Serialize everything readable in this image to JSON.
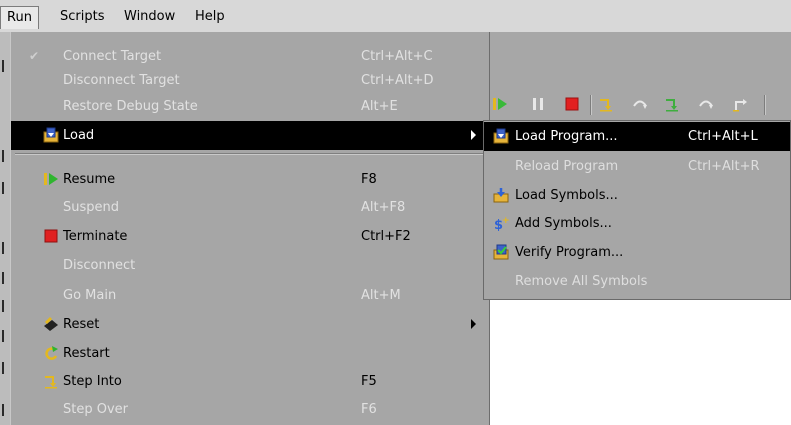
{
  "menubar": {
    "items": [
      "Run",
      "Scripts",
      "Window",
      "Help"
    ]
  },
  "run_menu": {
    "items": [
      {
        "label": "Connect Target",
        "accel": "Ctrl+Alt+C",
        "enabled": false,
        "checked": true
      },
      {
        "label": "Disconnect Target",
        "accel": "Ctrl+Alt+D",
        "enabled": false
      },
      {
        "label": "Restore Debug State",
        "accel": "Alt+E",
        "enabled": false
      },
      {
        "label": "Load",
        "accel": "",
        "enabled": true,
        "highlighted": true,
        "submenu": true,
        "icon": "load-icon"
      },
      {
        "label": "Resume",
        "accel": "F8",
        "enabled": true,
        "icon": "resume-icon"
      },
      {
        "label": "Suspend",
        "accel": "Alt+F8",
        "enabled": false
      },
      {
        "label": "Terminate",
        "accel": "Ctrl+F2",
        "enabled": true,
        "icon": "terminate-icon"
      },
      {
        "label": "Disconnect",
        "accel": "",
        "enabled": false
      },
      {
        "label": "Go Main",
        "accel": "Alt+M",
        "enabled": false
      },
      {
        "label": "Reset",
        "accel": "",
        "enabled": true,
        "submenu": true,
        "icon": "reset-icon"
      },
      {
        "label": "Restart",
        "accel": "",
        "enabled": true,
        "icon": "restart-icon"
      },
      {
        "label": "Step Into",
        "accel": "F5",
        "enabled": true,
        "icon": "step-into-icon"
      },
      {
        "label": "Step Over",
        "accel": "F6",
        "enabled": false
      }
    ]
  },
  "load_submenu": {
    "items": [
      {
        "label": "Load Program...",
        "accel": "Ctrl+Alt+L",
        "enabled": true,
        "highlighted": true,
        "icon": "load-program-icon"
      },
      {
        "label": "Reload Program",
        "accel": "Ctrl+Alt+R",
        "enabled": false
      },
      {
        "label": "Load Symbols...",
        "accel": "",
        "enabled": true,
        "icon": "load-symbols-icon"
      },
      {
        "label": "Add Symbols...",
        "accel": "",
        "enabled": true,
        "icon": "add-symbols-icon"
      },
      {
        "label": "Verify Program...",
        "accel": "",
        "enabled": true,
        "icon": "verify-program-icon"
      },
      {
        "label": "Remove All Symbols",
        "accel": "",
        "enabled": false
      }
    ]
  },
  "toolbar": {
    "icons": [
      "resume-icon",
      "suspend-icon",
      "terminate-icon",
      "step-into-icon",
      "step-over-icon",
      "step-into-icon",
      "step-over-icon",
      "step-return-icon"
    ]
  },
  "colors": {
    "menu_bg": "#a6a6a6",
    "highlight_bg": "#000000",
    "disabled_text": "#e1e1e1",
    "resume_green": "#2fb52f",
    "terminate_red": "#e02020"
  }
}
